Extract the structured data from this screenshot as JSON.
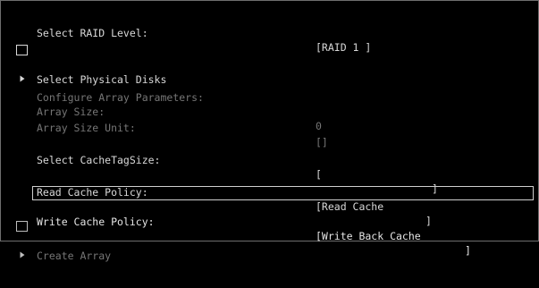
{
  "raid_level": {
    "label": "Select RAID Level:",
    "value": "[RAID 1 ]"
  },
  "physical_disks": {
    "label": "Select Physical Disks",
    "icon": "arrow-right-icon"
  },
  "array_params": {
    "heading": "Configure Array Parameters:",
    "size_label": "Array Size:",
    "size_value": "0",
    "unit_label": "Array Size Unit:",
    "unit_value": "[]"
  },
  "cache_tag_size": {
    "label": "Select CacheTagSize:",
    "value_open": "[",
    "value_close": "]"
  },
  "read_cache": {
    "label": "Read Cache Policy:",
    "value_open": "[Read Cache",
    "value_close": "]"
  },
  "write_cache": {
    "label": "Write Cache Policy:",
    "value_open": "[Write Back Cache",
    "value_close": "]"
  },
  "create_array": {
    "label": "Create Array",
    "icon": "arrow-right-icon"
  },
  "colors": {
    "background": "#000000",
    "text": "#d8d8d8",
    "disabled_text": "#767676",
    "selection_border": "#cfcfcf"
  }
}
